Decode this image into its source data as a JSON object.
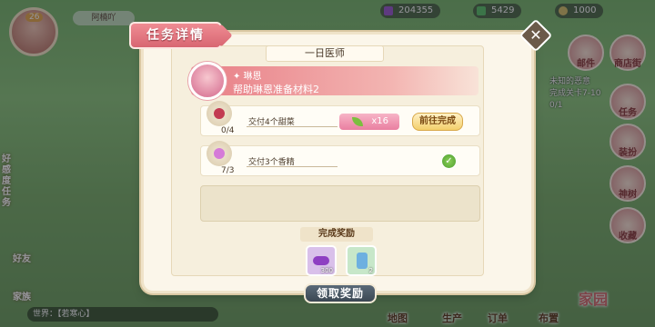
{
  "hud": {
    "level": "26",
    "player_name": "阿楠吖",
    "resources": [
      {
        "value": "204355",
        "icon": "purple-gem-icon",
        "color": "#9b59d0"
      },
      {
        "value": "5429",
        "icon": "green-gem-icon",
        "color": "#5cc46a"
      },
      {
        "value": "1000",
        "icon": "star-coin-icon",
        "color": "#d6c26a"
      }
    ],
    "right_side": [
      "邮件",
      "商店街",
      "任务",
      "装扮",
      "神树",
      "收藏"
    ],
    "quest_tracker": {
      "title": "未知的恶意",
      "step": "完成关卡7-10",
      "progress": "0/1"
    },
    "left_side": [
      "好友",
      "家族"
    ],
    "left_vertical": "好感度任务",
    "bottom_nav": [
      "地图",
      "生产",
      "订单",
      "布置",
      "家园"
    ],
    "chat_text": "世界：【若寒心】"
  },
  "dialog": {
    "title": "任务详情",
    "close_icon": "close-x-icon",
    "quest_name": "一日医师",
    "npc": {
      "name": "✦ 琳恩",
      "desc": "帮助琳恩准备材料2"
    },
    "tasks": [
      {
        "text": "交付4个甜菜",
        "count": "0/4",
        "reward_amount": "x16",
        "action": "前往完成",
        "icon": "beet-icon",
        "color": "#c23a52",
        "done": false
      },
      {
        "text": "交付3个香精",
        "count": "7/3",
        "icon": "essence-flask-icon",
        "color": "#d57ad8",
        "done": true
      }
    ],
    "reward_title": "完成奖励",
    "rewards": [
      {
        "icon": "purple-gems-icon",
        "qty": "300",
        "color": "#d9c0ea"
      },
      {
        "icon": "potion-card-icon",
        "qty": "2",
        "color": "#c7e7c9"
      }
    ],
    "claim_label": "领取奖励"
  }
}
